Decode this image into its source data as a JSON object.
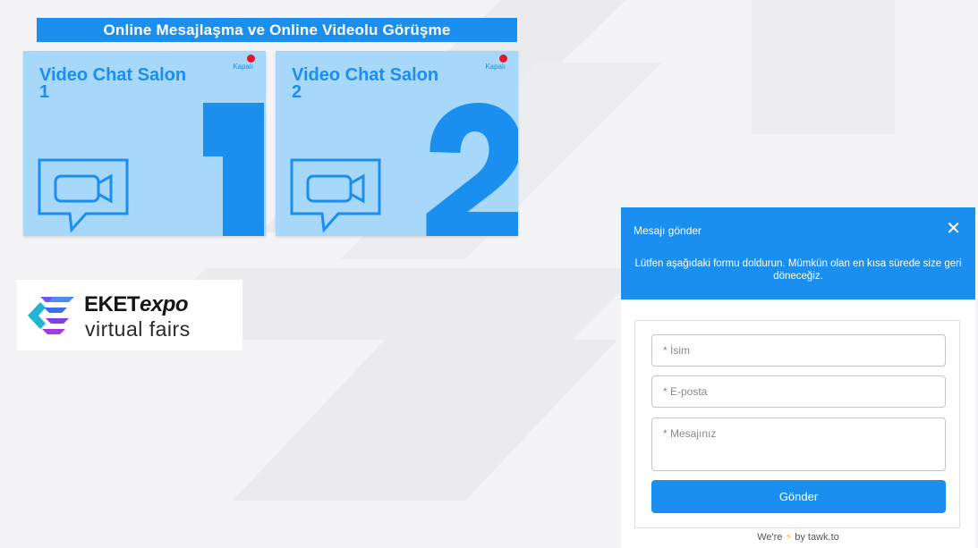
{
  "header": {
    "title": "Online Mesajlaşma ve Online Videolu Görüşme"
  },
  "rooms": [
    {
      "title": "Video Chat Salon 1",
      "status": "Kapalı",
      "number": "1"
    },
    {
      "title": "Video Chat Salon 2",
      "status": "Kapalı",
      "number": "2"
    }
  ],
  "logo": {
    "brand": "EKET",
    "brand_suffix": "expo",
    "tagline": "virtual fairs"
  },
  "chat": {
    "title": "Mesajı gönder",
    "intro": "Lütfen aşağıdaki formu doldurun. Mümkün olan en kısa sürede size geri döneceğiz.",
    "name_placeholder": "* İsim",
    "email_placeholder": "* E-posta",
    "message_placeholder": "* Mesajınız",
    "submit_label": "Gönder",
    "powered_prefix": "We're",
    "powered_by": "by tawk.to"
  },
  "colors": {
    "accent": "#1a8ff0",
    "card": "#a7d8fa",
    "status_dot": "#e8162d"
  }
}
